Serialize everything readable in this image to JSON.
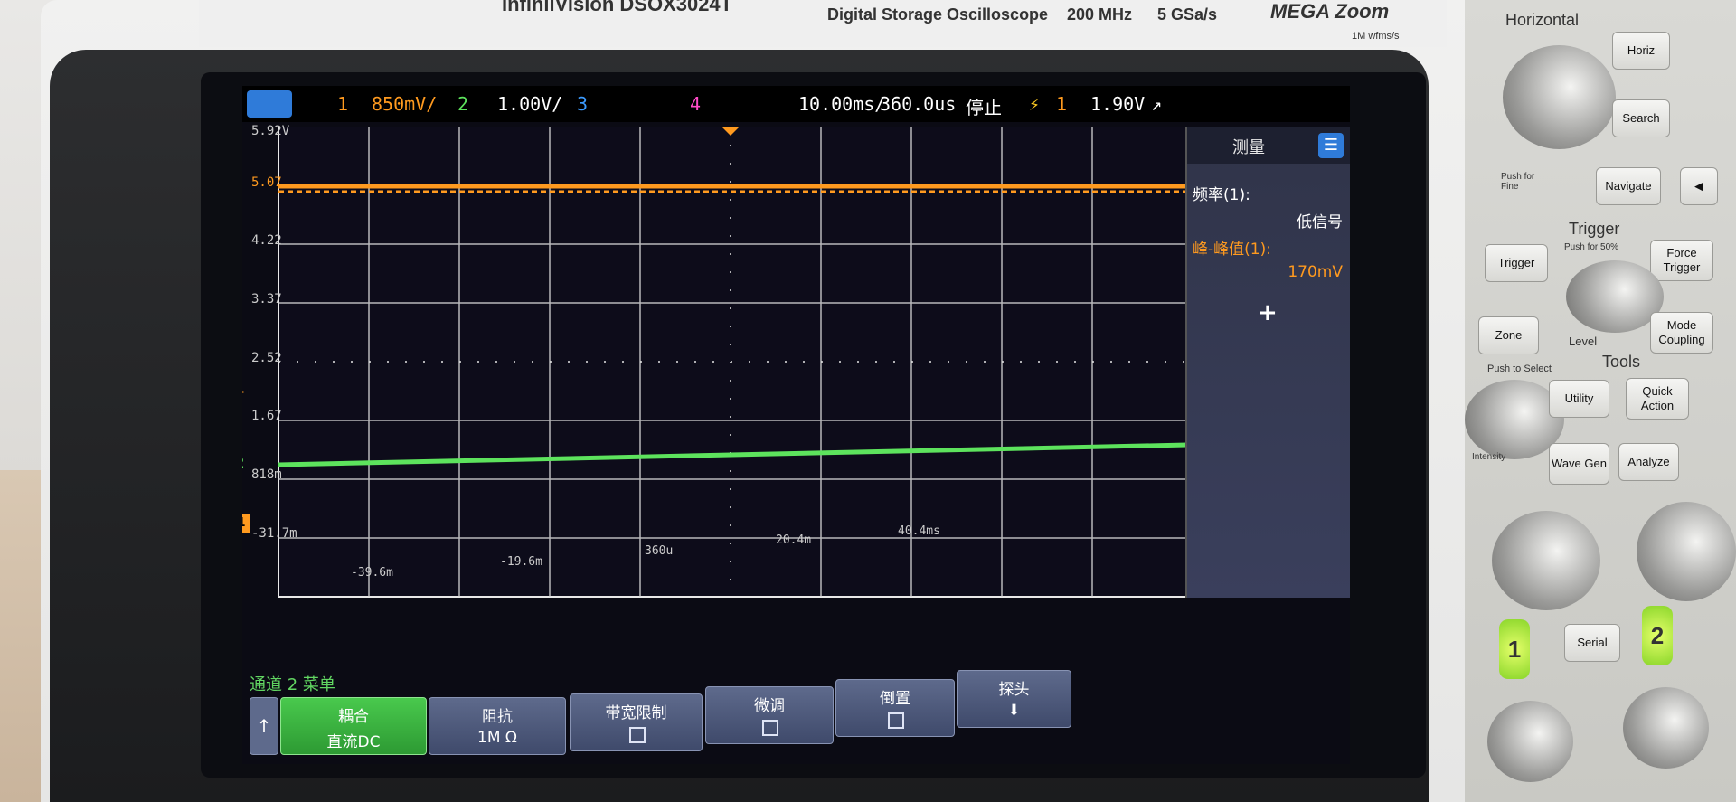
{
  "brand": {
    "model": "InfiniiVision DSOX3024T",
    "description": "Digital Storage Oscilloscope",
    "bandwidth": "200 MHz",
    "sample_rate": "5 GSa/s",
    "logo": "MEGA Zoom",
    "logo_sub": "1M wfms/s"
  },
  "status_bar": {
    "ch1_num": "1",
    "ch1_scale": "850mV/",
    "ch2_num": "2",
    "ch2_scale": "1.00V/",
    "ch3_num": "3",
    "ch4_num": "4",
    "timebase": "10.00ms/",
    "delay": "360.0us",
    "run_state": "停止",
    "trig_src": "1",
    "trig_level": "1.90V"
  },
  "scale_labels": {
    "y1": "5.92V",
    "y2": "5.07",
    "y3": "4.22",
    "y4": "3.37",
    "y5": "2.52",
    "y6": "1.67",
    "y7": "818m",
    "y8": "-31.7m",
    "x1": "-39.6m",
    "x2": "-19.6m",
    "x3": "360u",
    "x4": "20.4m",
    "x5": "40.4ms",
    "trig_marker": "T",
    "ch2_marker": "2"
  },
  "measure": {
    "title": "测量",
    "freq_label": "频率(1):",
    "freq_value": "低信号",
    "pp_label": "峰-峰值(1):",
    "pp_value": "170mV",
    "add": "+"
  },
  "softkeys": {
    "menu_title": "通道 2 菜单",
    "coupling_label": "耦合",
    "coupling_value": "直流DC",
    "impedance_label": "阻抗",
    "impedance_value": "1M Ω",
    "bw_limit_label": "带宽限制",
    "fine_label": "微调",
    "invert_label": "倒置",
    "probe_label": "探头"
  },
  "panel": {
    "horizontal": "Horizontal",
    "horiz_btn": "Horiz",
    "search_btn": "Search",
    "push_fine": "Push for Fine",
    "navigate": "Navigate",
    "trigger_sec": "Trigger",
    "trigger_btn": "Trigger",
    "force_trigger": "Force Trigger",
    "push_50": "Push for 50%",
    "zone": "Zone",
    "level": "Level",
    "mode_coupling": "Mode Coupling",
    "tools": "Tools",
    "push_select": "Push to Select",
    "utility": "Utility",
    "quick_action": "Quick Action",
    "intensity": "Intensity",
    "wave_gen": "Wave Gen",
    "analyze": "Analyze",
    "ch1": "1",
    "serial": "Serial",
    "ch2": "2"
  },
  "colors": {
    "ch1": "#ff9a1f",
    "ch2": "#5de35d",
    "ch3": "#3c9bff",
    "ch4": "#ff4bc8",
    "accent": "#2f7bd9"
  }
}
